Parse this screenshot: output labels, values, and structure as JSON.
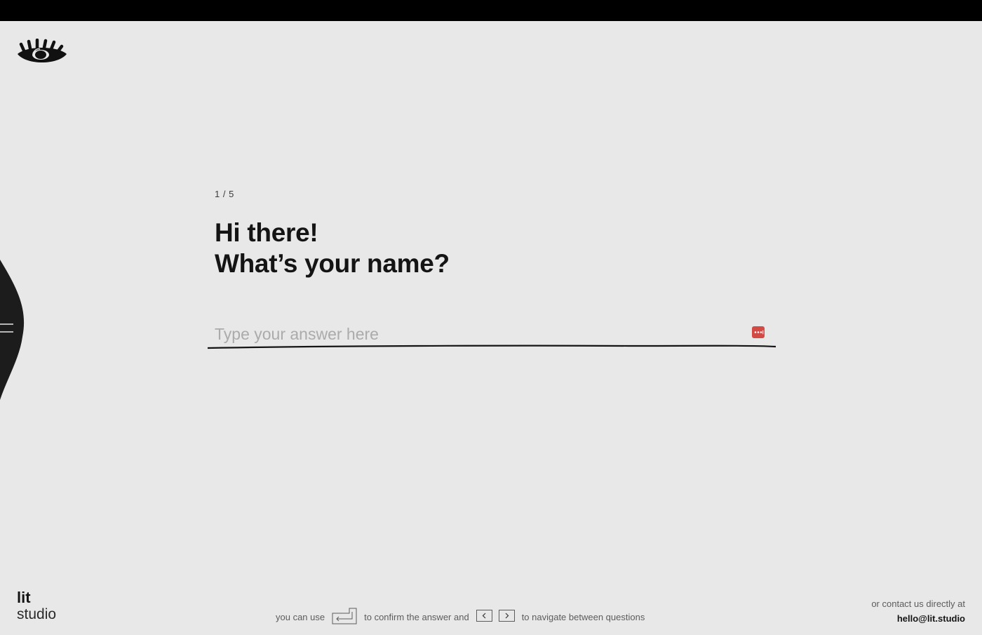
{
  "brand": {
    "logo_icon": "eye-logo-icon",
    "line1": "lit",
    "line2": "studio"
  },
  "menu": {
    "icon": "hamburger-menu-icon"
  },
  "form": {
    "counter": "1 / 5",
    "question_line1": "Hi there!",
    "question_line2": "What’s your name?",
    "answer_placeholder": "Type your answer here",
    "answer_value": "",
    "autofill_icon": "password-manager-icon",
    "accent_color": "#d34a45"
  },
  "hint": {
    "text_before": "you can use",
    "enter_key_icon": "enter-key-icon",
    "text_middle": "to confirm the answer and",
    "prev_key_icon": "arrow-left-key-icon",
    "next_key_icon": "arrow-right-key-icon",
    "text_after": "to navigate between questions"
  },
  "contact": {
    "label": "or contact us directly at",
    "email": "hello@lit.studio"
  },
  "colors": {
    "background": "#e8e8e8",
    "topbar": "#000000",
    "text": "#141414"
  }
}
